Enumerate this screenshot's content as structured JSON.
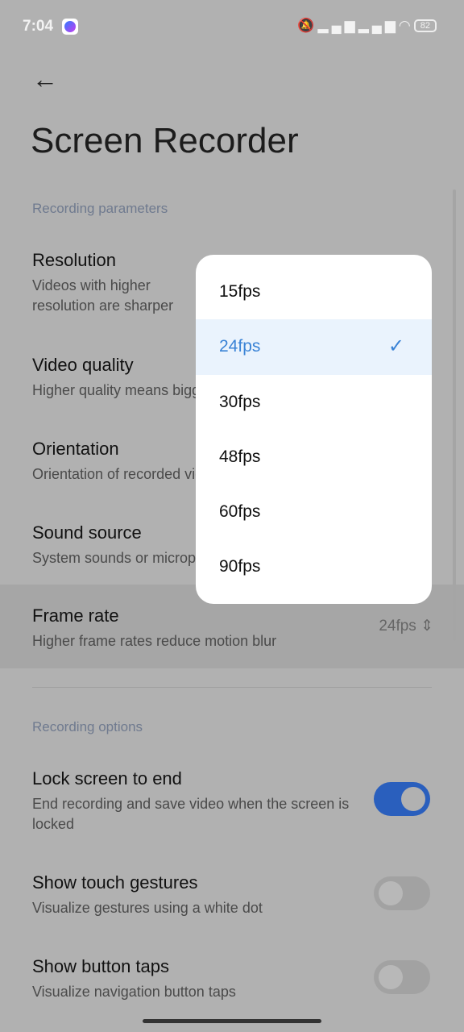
{
  "status": {
    "time": "7:04",
    "battery": "82",
    "icons": [
      "messenger-icon",
      "silent-icon",
      "signal-icon",
      "signal-icon",
      "wifi-icon",
      "battery-icon"
    ]
  },
  "header": {
    "title": "Screen Recorder"
  },
  "sections": [
    {
      "label": "Recording parameters",
      "items": [
        {
          "title": "Resolution",
          "subtitle": "Videos with higher resolution are sharper"
        },
        {
          "title": "Video quality",
          "subtitle": "Higher quality means bigger files"
        },
        {
          "title": "Orientation",
          "subtitle": "Orientation of recorded videos"
        },
        {
          "title": "Sound source",
          "subtitle": "System sounds or microphone"
        },
        {
          "title": "Frame rate",
          "subtitle": "Higher frame rates reduce motion blur",
          "value": "24fps"
        }
      ]
    },
    {
      "label": "Recording options",
      "items": [
        {
          "title": "Lock screen to end",
          "subtitle": "End recording and save video when the screen is locked",
          "on": true
        },
        {
          "title": "Show touch gestures",
          "subtitle": "Visualize gestures using a white dot",
          "on": false
        },
        {
          "title": "Show button taps",
          "subtitle": "Visualize navigation button taps",
          "on": false
        }
      ]
    }
  ],
  "popup": {
    "options": [
      "15fps",
      "24fps",
      "30fps",
      "48fps",
      "60fps",
      "90fps"
    ],
    "selected": "24fps"
  },
  "colors": {
    "accent": "#3a83d6",
    "toggle_on": "#2a5fbd"
  }
}
